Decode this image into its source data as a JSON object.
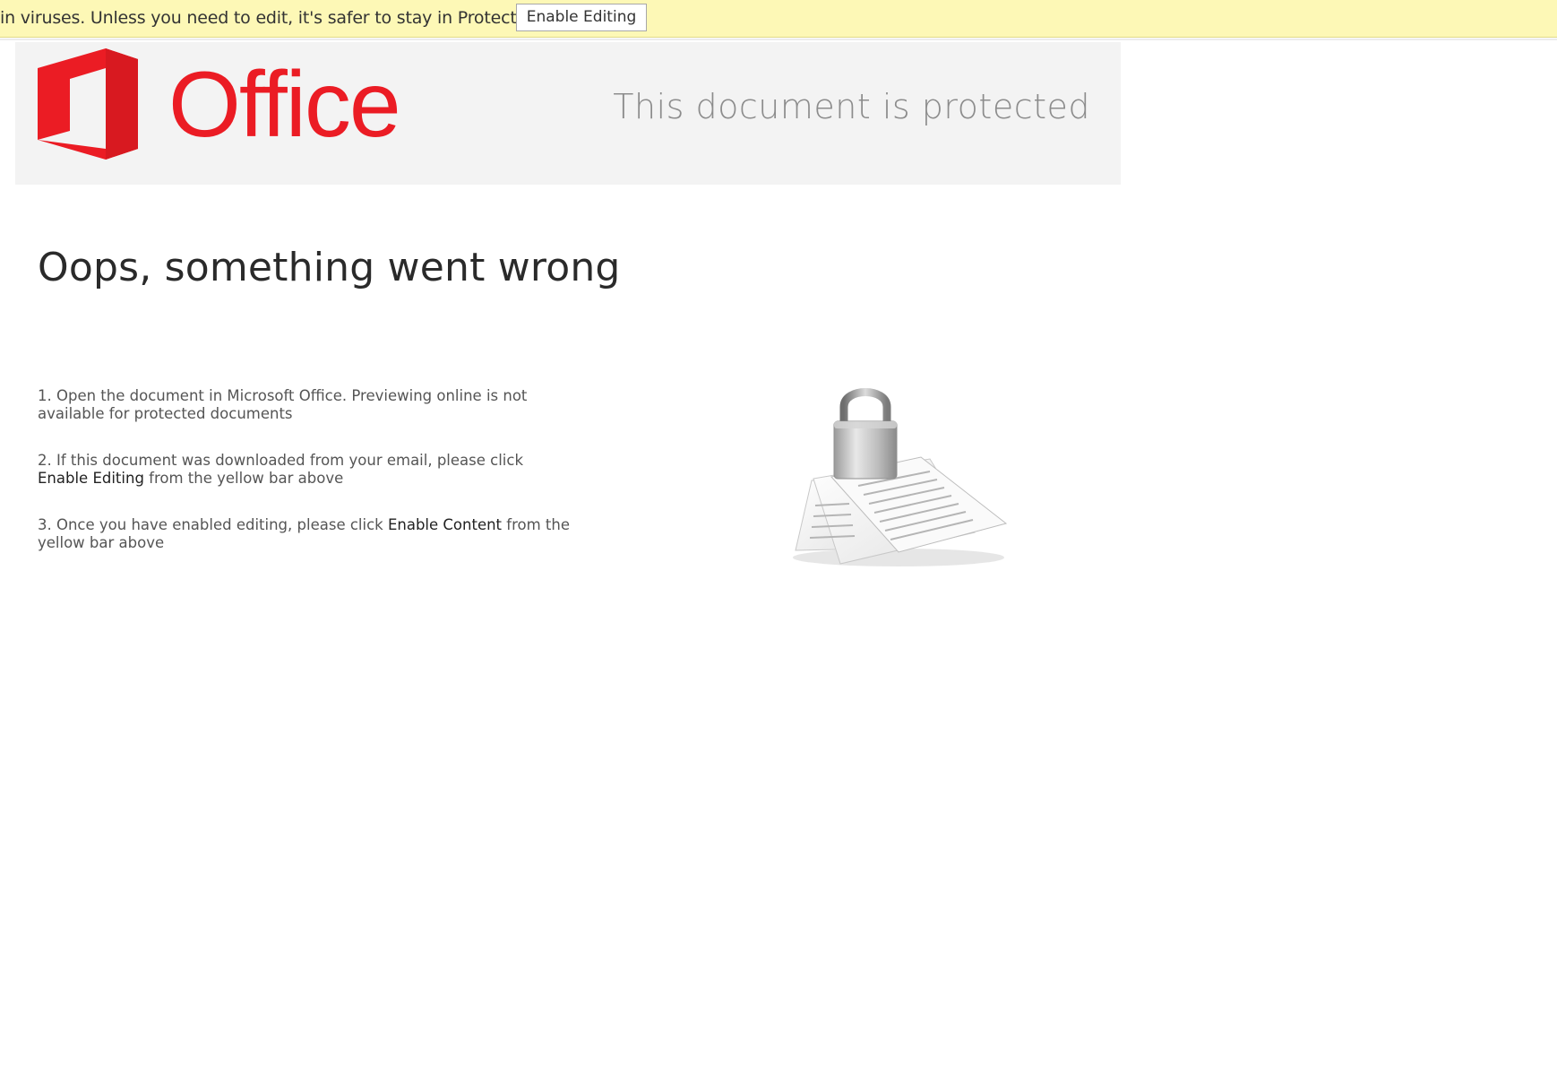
{
  "message_bar": {
    "text": "in viruses. Unless you need to edit, it's safer to stay in Protected View.",
    "button_label": "Enable Editing",
    "background": "#fdf8b6"
  },
  "header": {
    "logo_text": "Office",
    "logo_color": "#eb1c24",
    "protected_label": "This document is protected"
  },
  "main": {
    "headline": "Oops, something went wrong",
    "steps": [
      {
        "text": "1. Open the document in Microsoft Office. Previewing online is not available for protected documents"
      },
      {
        "before": "2. If this document was downloaded from your email, please click ",
        "emphasis": "Enable Editing",
        "after": " from the yellow bar above"
      },
      {
        "before": "3. Once you have enabled editing, please click ",
        "emphasis": "Enable Content",
        "after": " from the yellow bar above"
      }
    ],
    "illustration": "padlock-on-documents-icon"
  }
}
